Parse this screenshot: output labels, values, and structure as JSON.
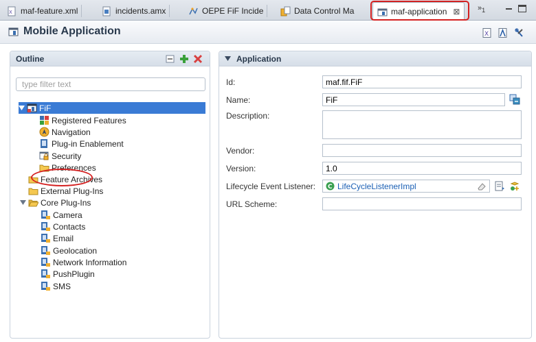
{
  "tabs": [
    {
      "label": "maf-feature.xml"
    },
    {
      "label": "incidents.amx"
    },
    {
      "label": "OEPE FiF Incide"
    },
    {
      "label": "Data Control Ma"
    },
    {
      "label": "maf-application"
    }
  ],
  "tab_overflow": "»",
  "tab_overflow_count": "1",
  "editor": {
    "title": "Mobile Application"
  },
  "outline": {
    "title": "Outline",
    "filter_placeholder": "type filter text",
    "tree": {
      "root": "FiF",
      "registered_features": "Registered Features",
      "navigation": "Navigation",
      "plugin_enablement": "Plug-in Enablement",
      "security": "Security",
      "preferences": "Preferences",
      "feature_archives": "Feature Archives",
      "external_plugins": "External Plug-Ins",
      "core_plugins": "Core Plug-Ins",
      "core_children": [
        "Camera",
        "Contacts",
        "Email",
        "Geolocation",
        "Network Information",
        "PushPlugin",
        "SMS"
      ]
    }
  },
  "application": {
    "title": "Application",
    "fields": {
      "id_label": "Id:",
      "id_value": "maf.fif.FiF",
      "name_label": "Name:",
      "name_value": "FiF",
      "description_label": "Description:",
      "description_value": "",
      "vendor_label": "Vendor:",
      "vendor_value": "",
      "version_label": "Version:",
      "version_value": "1.0",
      "lifecycle_label": "Lifecycle Event Listener:",
      "lifecycle_value": "LifeCycleListenerImpl",
      "url_scheme_label": "URL Scheme:",
      "url_scheme_value": ""
    }
  },
  "colors": {
    "selection": "#3a7bd5",
    "annotation_red": "#d42020",
    "link_blue": "#1a5fb4"
  }
}
